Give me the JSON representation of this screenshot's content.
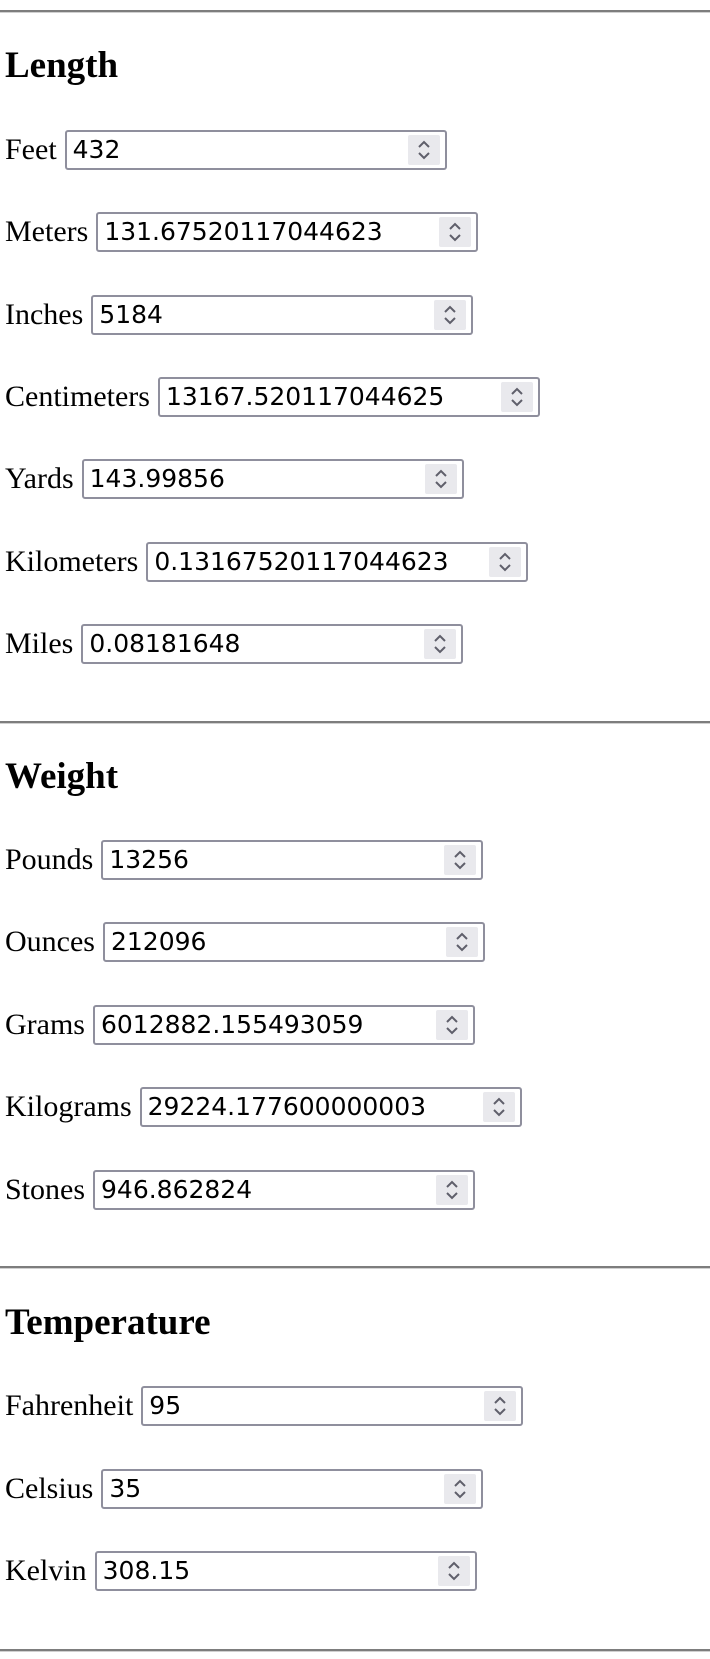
{
  "sections": [
    {
      "title": "Length",
      "fields": [
        {
          "label": "Feet",
          "value": "432"
        },
        {
          "label": "Meters",
          "value": "131.67520117044623"
        },
        {
          "label": "Inches",
          "value": "5184"
        },
        {
          "label": "Centimeters",
          "value": "13167.520117044625"
        },
        {
          "label": "Yards",
          "value": "143.99856"
        },
        {
          "label": "Kilometers",
          "value": "0.13167520117044623"
        },
        {
          "label": "Miles",
          "value": "0.08181648"
        }
      ]
    },
    {
      "title": "Weight",
      "fields": [
        {
          "label": "Pounds",
          "value": "13256"
        },
        {
          "label": "Ounces",
          "value": "212096"
        },
        {
          "label": "Grams",
          "value": "6012882.155493059"
        },
        {
          "label": "Kilograms",
          "value": "29224.177600000003"
        },
        {
          "label": "Stones",
          "value": "946.862824"
        }
      ]
    },
    {
      "title": "Temperature",
      "fields": [
        {
          "label": "Fahrenheit",
          "value": "95"
        },
        {
          "label": "Celsius",
          "value": "35"
        },
        {
          "label": "Kelvin",
          "value": "308.15"
        }
      ]
    }
  ],
  "icons": {
    "spinner": "chevron-up-down-icon"
  },
  "colors": {
    "rule": "#7d7d7d",
    "field_border": "#8f8f9d",
    "spinner_bg": "#e9e9ed",
    "spinner_glyph": "#5f5f6b"
  }
}
